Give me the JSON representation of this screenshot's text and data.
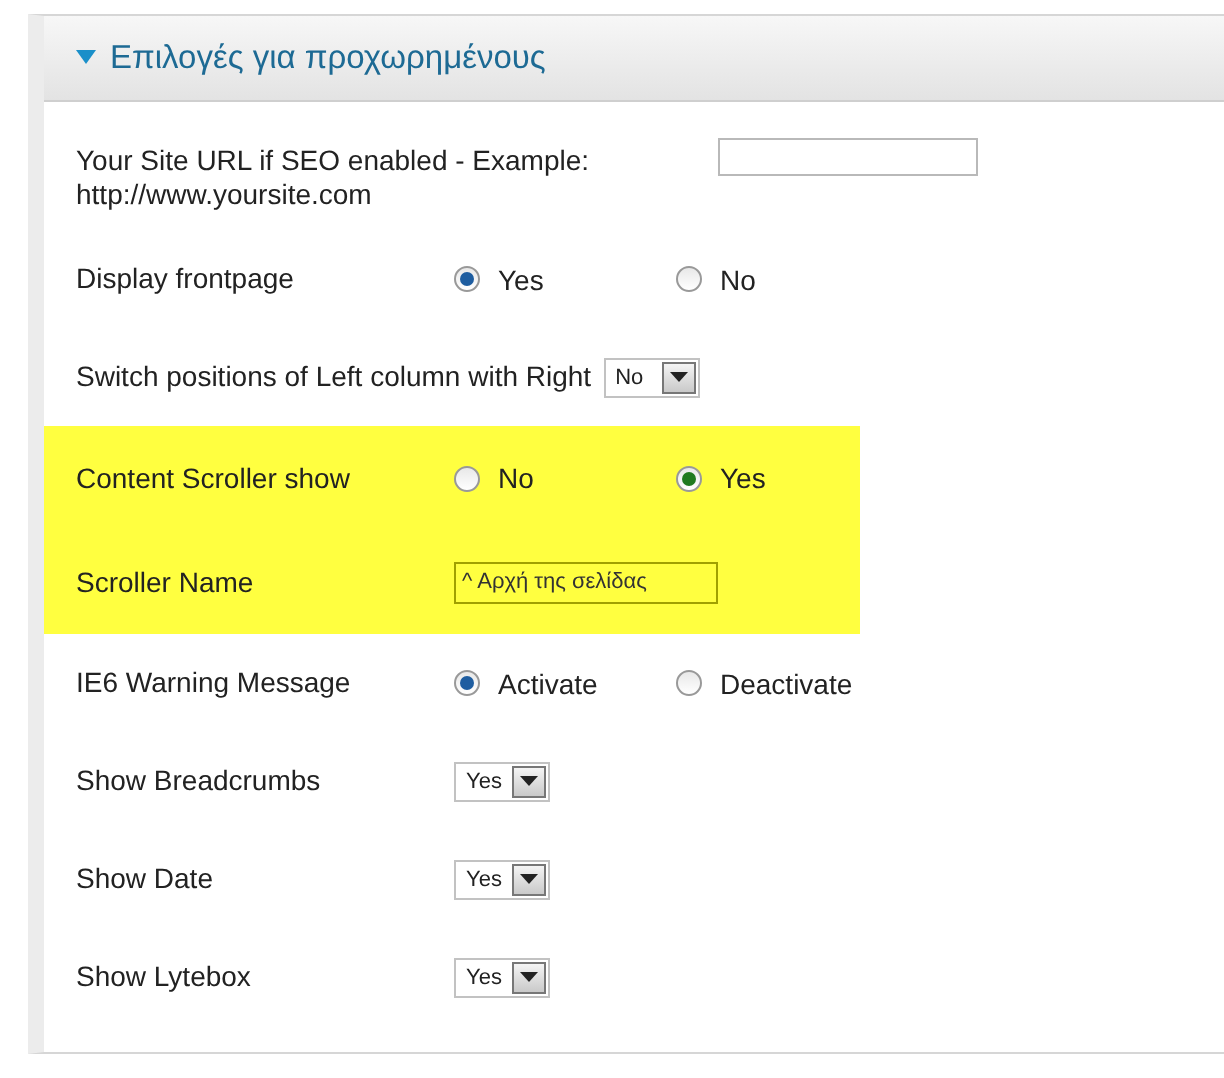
{
  "panel": {
    "title": "Επιλογές για προχωρημένους",
    "expanded": true
  },
  "rows": [
    {
      "kind": "text",
      "label": "Your Site URL if SEO enabled - Example: http://www.yoursite.com",
      "highlighted": false,
      "value": ""
    },
    {
      "kind": "radio",
      "label": "Display frontpage",
      "highlighted": false,
      "options": [
        {
          "label": "Yes",
          "selected": true
        },
        {
          "label": "No",
          "selected": false
        }
      ]
    },
    {
      "kind": "inline-select",
      "label": "Switch positions of Left column with Right",
      "highlighted": false,
      "value": "No"
    },
    {
      "kind": "radio",
      "label": "Content Scroller show",
      "highlighted": true,
      "options": [
        {
          "label": "No",
          "selected": false
        },
        {
          "label": "Yes",
          "selected": true
        }
      ]
    },
    {
      "kind": "text",
      "label": "Scroller Name",
      "highlighted": true,
      "value": "^ Αρχή της σελίδας"
    },
    {
      "kind": "radio",
      "label": "IE6 Warning Message",
      "highlighted": false,
      "options": [
        {
          "label": "Activate",
          "selected": true
        },
        {
          "label": "Deactivate",
          "selected": false
        }
      ]
    },
    {
      "kind": "select",
      "label": "Show Breadcrumbs",
      "highlighted": false,
      "value": "Yes"
    },
    {
      "kind": "select",
      "label": "Show Date",
      "highlighted": false,
      "value": "Yes"
    },
    {
      "kind": "select",
      "label": "Show Lytebox",
      "highlighted": false,
      "value": "Yes"
    }
  ]
}
